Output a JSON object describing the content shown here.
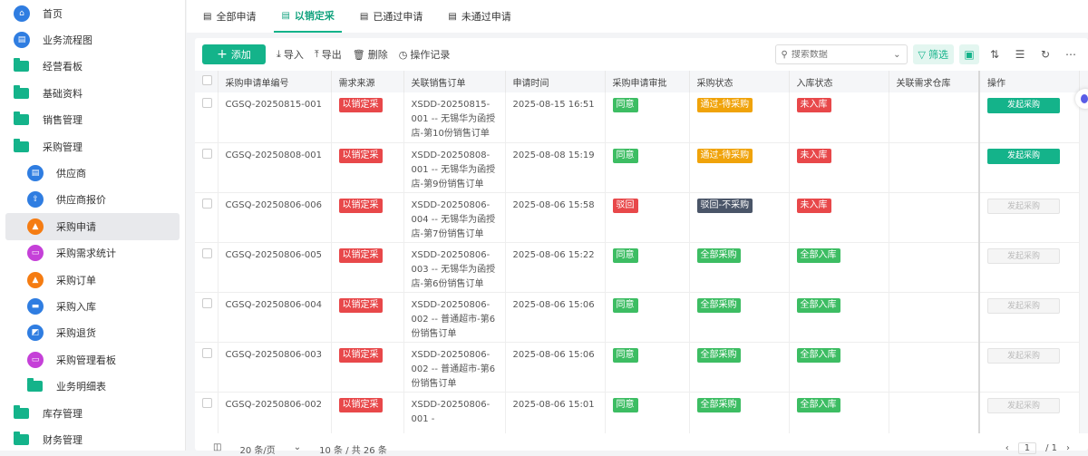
{
  "sidebar": {
    "items": [
      {
        "label": "首页",
        "icon": "home-icon",
        "type": "circle",
        "color": "#2f7de1",
        "sub": false
      },
      {
        "label": "业务流程图",
        "icon": "document-icon",
        "type": "circle",
        "color": "#2f7de1",
        "sub": false
      },
      {
        "label": "经营看板",
        "icon": "folder-icon",
        "type": "folder",
        "sub": false
      },
      {
        "label": "基础资料",
        "icon": "folder-icon",
        "type": "folder",
        "sub": false
      },
      {
        "label": "销售管理",
        "icon": "folder-icon",
        "type": "folder",
        "sub": false
      },
      {
        "label": "采购管理",
        "icon": "folder-open-icon",
        "type": "folder",
        "sub": false
      },
      {
        "label": "供应商",
        "icon": "document-icon",
        "type": "circle",
        "color": "#2f7de1",
        "sub": true
      },
      {
        "label": "供应商报价",
        "icon": "house-upload-icon",
        "type": "circle",
        "color": "#2f7de1",
        "sub": true
      },
      {
        "label": "采购申请",
        "icon": "clipboard-icon",
        "type": "circle",
        "color": "#f57c12",
        "sub": true,
        "active": true
      },
      {
        "label": "采购需求统计",
        "icon": "monitor-chart-icon",
        "type": "circle",
        "color": "#c540d8",
        "sub": true
      },
      {
        "label": "采购订单",
        "icon": "clipboard-icon",
        "type": "circle",
        "color": "#f57c12",
        "sub": true
      },
      {
        "label": "采购入库",
        "icon": "truck-icon",
        "type": "circle",
        "color": "#2f7de1",
        "sub": true
      },
      {
        "label": "采购退货",
        "icon": "return-bag-icon",
        "type": "circle",
        "color": "#2f7de1",
        "sub": true
      },
      {
        "label": "采购管理看板",
        "icon": "monitor-chart-icon",
        "type": "circle",
        "color": "#c540d8",
        "sub": true
      },
      {
        "label": "业务明细表",
        "icon": "folder-icon",
        "type": "folder",
        "sub": true
      },
      {
        "label": "库存管理",
        "icon": "folder-icon",
        "type": "folder",
        "sub": false
      },
      {
        "label": "财务管理",
        "icon": "folder-icon",
        "type": "folder",
        "sub": false
      }
    ]
  },
  "tabs": [
    {
      "label": "全部申请"
    },
    {
      "label": "以销定采",
      "active": true
    },
    {
      "label": "已通过申请"
    },
    {
      "label": "未通过申请"
    }
  ],
  "toolbar": {
    "add": "添加",
    "import": "导入",
    "export": "导出",
    "delete": "删除",
    "log": "操作记录",
    "search_placeholder": "搜索数据",
    "filter": "筛选"
  },
  "columns": [
    "采购申请单编号",
    "需求来源",
    "关联销售订单",
    "申请时间",
    "采购申请审批",
    "采购状态",
    "入库状态",
    "关联需求仓库",
    "操作"
  ],
  "rows": [
    {
      "id": "CGSQ-20250815-001",
      "source": "以销定采",
      "order": "XSDD-20250815-001 -- 无锡华为函授店-第10份销售订单",
      "time": "2025-08-15 16:51",
      "approval": "同意",
      "approval_color": "g",
      "purchase": "通过-待采购",
      "purchase_color": "o",
      "stock": "未入库",
      "stock_color": "r",
      "action": "发起采购",
      "enabled": true
    },
    {
      "id": "CGSQ-20250808-001",
      "source": "以销定采",
      "order": "XSDD-20250808-001 -- 无锡华为函授店-第9份销售订单",
      "time": "2025-08-08 15:19",
      "approval": "同意",
      "approval_color": "g",
      "purchase": "通过-待采购",
      "purchase_color": "o",
      "stock": "未入库",
      "stock_color": "r",
      "action": "发起采购",
      "enabled": true
    },
    {
      "id": "CGSQ-20250806-006",
      "source": "以销定采",
      "order": "XSDD-20250806-004 -- 无锡华为函授店-第7份销售订单",
      "time": "2025-08-06 15:58",
      "approval": "驳回",
      "approval_color": "r",
      "purchase": "驳回-不采购",
      "purchase_color": "d",
      "stock": "未入库",
      "stock_color": "r",
      "action": "发起采购",
      "enabled": false
    },
    {
      "id": "CGSQ-20250806-005",
      "source": "以销定采",
      "order": "XSDD-20250806-003 -- 无锡华为函授店-第6份销售订单",
      "time": "2025-08-06 15:22",
      "approval": "同意",
      "approval_color": "g",
      "purchase": "全部采购",
      "purchase_color": "g",
      "stock": "全部入库",
      "stock_color": "g",
      "action": "发起采购",
      "enabled": false
    },
    {
      "id": "CGSQ-20250806-004",
      "source": "以销定采",
      "order": "XSDD-20250806-002 -- 普通超市-第6份销售订单",
      "time": "2025-08-06 15:06",
      "approval": "同意",
      "approval_color": "g",
      "purchase": "全部采购",
      "purchase_color": "g",
      "stock": "全部入库",
      "stock_color": "g",
      "action": "发起采购",
      "enabled": false
    },
    {
      "id": "CGSQ-20250806-003",
      "source": "以销定采",
      "order": "XSDD-20250806-002 -- 普通超市-第6份销售订单",
      "time": "2025-08-06 15:06",
      "approval": "同意",
      "approval_color": "g",
      "purchase": "全部采购",
      "purchase_color": "g",
      "stock": "全部入库",
      "stock_color": "g",
      "action": "发起采购",
      "enabled": false
    },
    {
      "id": "CGSQ-20250806-002",
      "source": "以销定采",
      "order": "XSDD-20250806-001 -",
      "time": "2025-08-06 15:01",
      "approval": "同意",
      "approval_color": "g",
      "purchase": "全部采购",
      "purchase_color": "g",
      "stock": "全部入库",
      "stock_color": "g",
      "action": "发起采购",
      "enabled": false
    }
  ],
  "footer": {
    "page_size": "20 条/页",
    "count": "10 条 / 共 26 条",
    "page": "1",
    "total_pages": "/ 1"
  }
}
